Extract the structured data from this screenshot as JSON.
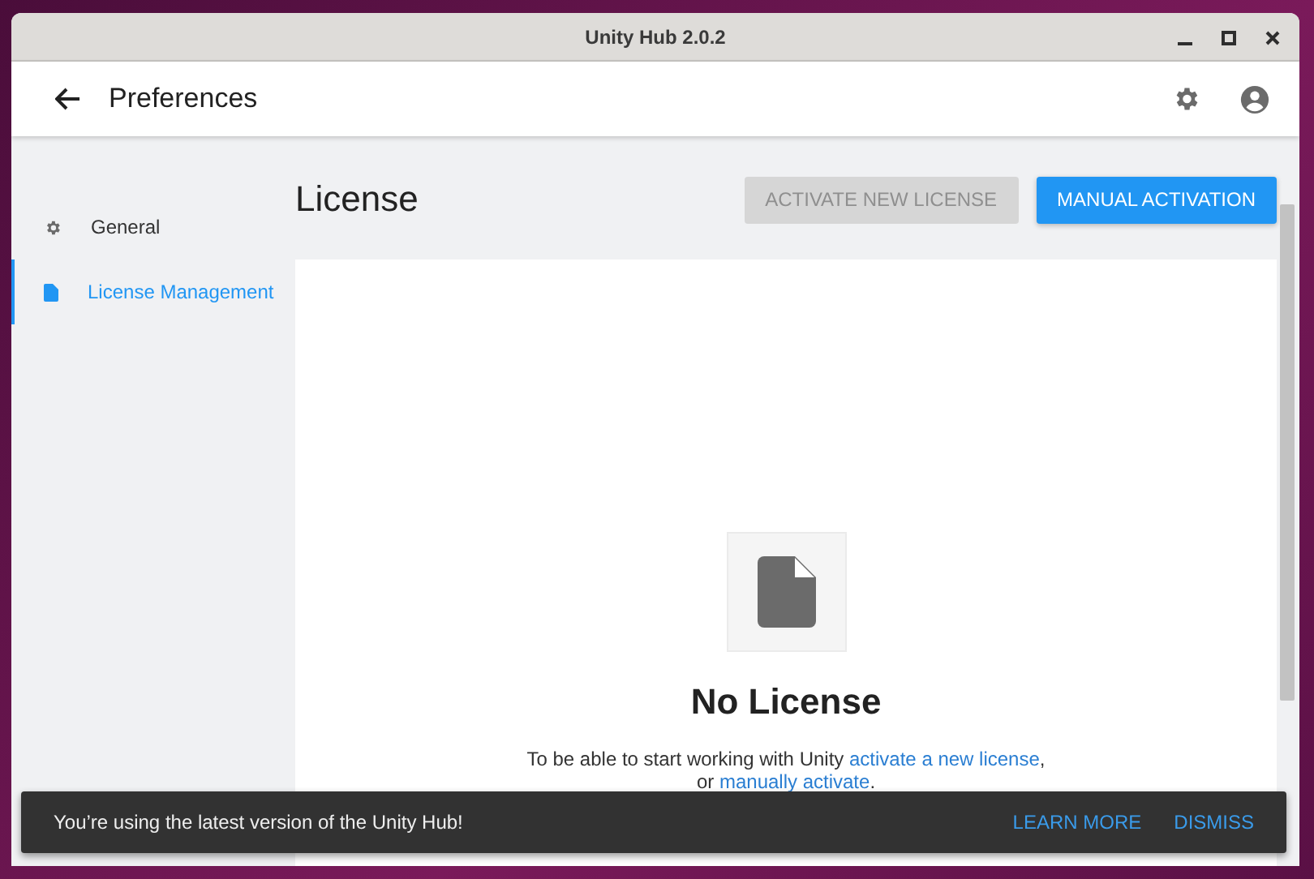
{
  "window": {
    "title": "Unity Hub 2.0.2"
  },
  "header": {
    "title": "Preferences"
  },
  "sidebar": {
    "items": [
      {
        "label": "General",
        "kind": "general",
        "selected": false
      },
      {
        "label": "License Management",
        "kind": "license",
        "selected": true
      }
    ]
  },
  "page": {
    "title": "License",
    "buttons": [
      {
        "label": "ACTIVATE NEW LICENSE",
        "disabled": true
      },
      {
        "label": "MANUAL ACTIVATION",
        "disabled": false
      }
    ]
  },
  "empty_state": {
    "title": "No License",
    "text_before": "To be able to start working with Unity",
    "link_1": "activate a new license",
    "text_middle": ", or",
    "link_2": "manually activate",
    "text_after": "."
  },
  "snackbar": {
    "message": "You’re using the latest version of the Unity Hub!",
    "actions": [
      "LEARN MORE",
      "DISMISS"
    ]
  }
}
